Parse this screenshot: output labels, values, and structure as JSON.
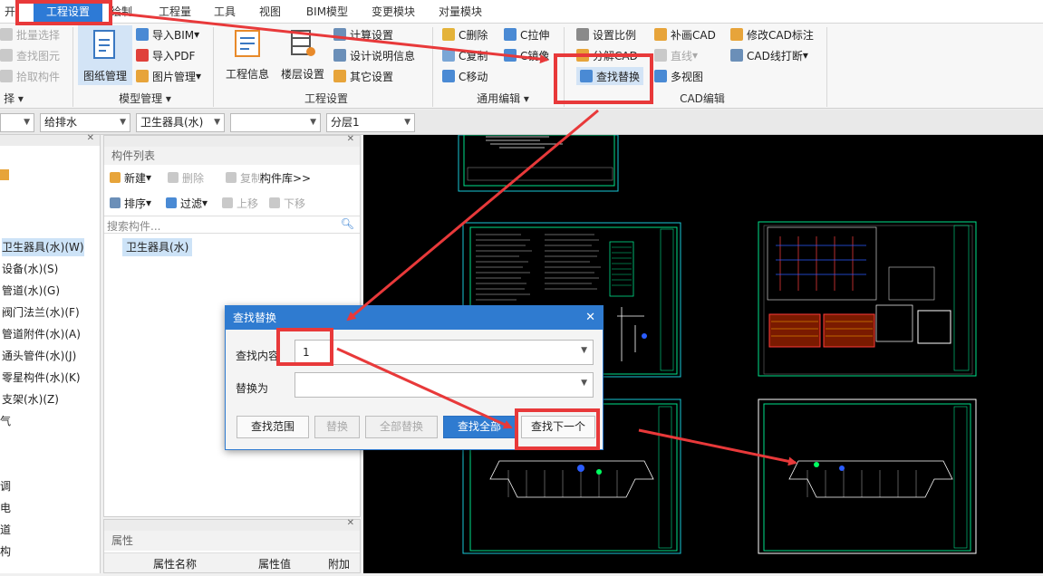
{
  "menubar": {
    "tabs": [
      "开始",
      "工程设置",
      "绘制",
      "工程量",
      "工具",
      "视图",
      "BIM模型",
      "变更模块",
      "对量模块"
    ]
  },
  "ribbon": {
    "select_group": {
      "batch_select": "批量选择",
      "find_element": "查找图元",
      "pick_component": "拾取构件",
      "label": "择"
    },
    "model_mgmt": {
      "drawing_mgmt": "图纸管理",
      "import_bim": "导入BIM",
      "import_pdf": "导入PDF",
      "image_mgmt": "图片管理",
      "label": "模型管理"
    },
    "project_settings": {
      "project_info": "工程信息",
      "floor_settings": "楼层设置",
      "calc_settings": "计算设置",
      "design_info": "设计说明信息",
      "other_settings": "其它设置",
      "label": "工程设置"
    },
    "general_edit": {
      "c_delete": "C删除",
      "c_copy": "C复制",
      "c_move": "C移动",
      "c_stretch": "C拉伸",
      "c_mirror": "C镜像",
      "label": "通用编辑"
    },
    "cad_edit": {
      "set_scale": "设置比例",
      "explode_cad": "分解CAD",
      "find_replace": "查找替换",
      "patch_cad": "补画CAD",
      "line": "直线",
      "multi_view": "多视图",
      "modify_cad_label": "修改CAD标注",
      "cad_line_break": "CAD线打断",
      "label": "CAD编辑"
    }
  },
  "selectors": {
    "s1": "",
    "s2": "给排水",
    "s3": "卫生器具(水)",
    "s4": "",
    "s5": "分层1"
  },
  "left_tree": {
    "items": [
      "卫生器具(水)(W)",
      "设备(水)(S)",
      "管道(水)(G)",
      "阀门法兰(水)(F)",
      "管道附件(水)(A)",
      "通头管件(水)(J)",
      "零星构件(水)(K)",
      "支架(水)(Z)",
      "气",
      "调",
      "电",
      "道",
      "构"
    ]
  },
  "component_panel": {
    "title": "构件列表",
    "new": "新建",
    "delete": "删除",
    "copy": "复制",
    "library": "构件库>>",
    "sort": "排序",
    "filter": "过滤",
    "move_up": "上移",
    "move_down": "下移",
    "search_placeholder": "搜索构件...",
    "items": [
      "卫生器具(水)"
    ]
  },
  "property_panel": {
    "title": "属性",
    "columns": [
      "属性名称",
      "属性值",
      "附加"
    ]
  },
  "dialog": {
    "title": "查找替换",
    "find_label": "查找内容",
    "find_value": "1",
    "replace_label": "替换为",
    "replace_value": "",
    "btn_scope": "查找范围",
    "btn_replace": "替换",
    "btn_replace_all": "全部替换",
    "btn_find_all": "查找全部",
    "btn_find_next": "查找下一个"
  },
  "colors": {
    "accent": "#2f7bd0",
    "annotation_red": "#e8393a",
    "cad_background": "#000000",
    "cad_frame": "#00e08a",
    "cad_border_cyan": "#19c7d6"
  }
}
